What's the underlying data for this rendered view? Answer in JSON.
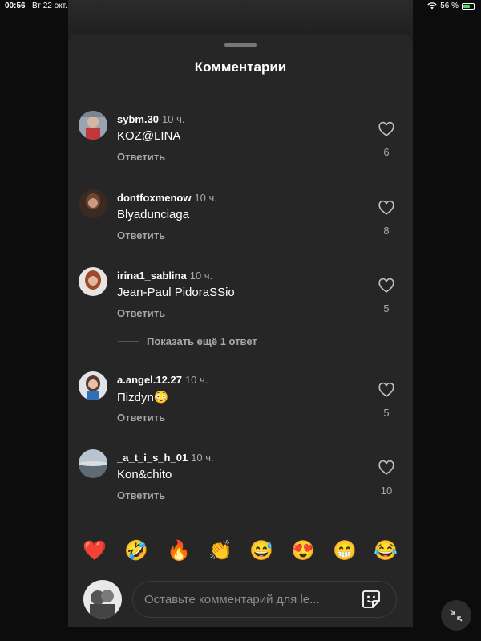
{
  "status_bar": {
    "time": "00:56",
    "date": "Вт 22 окт.",
    "battery": "56 %",
    "battery_level": 0.56
  },
  "sheet": {
    "title": "Комментарии"
  },
  "comments": [
    {
      "username": "sybm.30",
      "time": "10 ч.",
      "text": "KOZ@LINA",
      "reply": "Ответить",
      "likes": "6"
    },
    {
      "username": "dontfoxmenow",
      "time": "10 ч.",
      "text": "Blyadunciaga",
      "reply": "Ответить",
      "likes": "8"
    },
    {
      "username": "irina1_sablina",
      "time": "10 ч.",
      "text": "Jean-Paul PidoraSSio",
      "reply": "Ответить",
      "likes": "5"
    },
    {
      "username": "a.angel.12.27",
      "time": "10 ч.",
      "text": "Пizdyn😳",
      "reply": "Ответить",
      "likes": "5"
    },
    {
      "username": "_a_t_i_s_h_01",
      "time": "10 ч.",
      "text": "Kon&chito",
      "reply": "Ответить",
      "likes": "10"
    }
  ],
  "more_replies": "Показать ещё 1 ответ",
  "emoji_bar": [
    "❤️",
    "🤣",
    "🔥",
    "👏",
    "😅",
    "😍",
    "😁",
    "😂"
  ],
  "composer": {
    "placeholder": "Оставьте комментарий для le..."
  },
  "icons": {
    "like": "heart-outline-icon",
    "sticker": "sticker-icon",
    "collapse": "collapse-arrows-icon",
    "wifi": "wifi-icon",
    "battery": "battery-charging-icon"
  },
  "colors": {
    "sheet_bg": "#262626",
    "secondary_text": "#a8a8a8",
    "battery_fill": "#4cd964"
  }
}
